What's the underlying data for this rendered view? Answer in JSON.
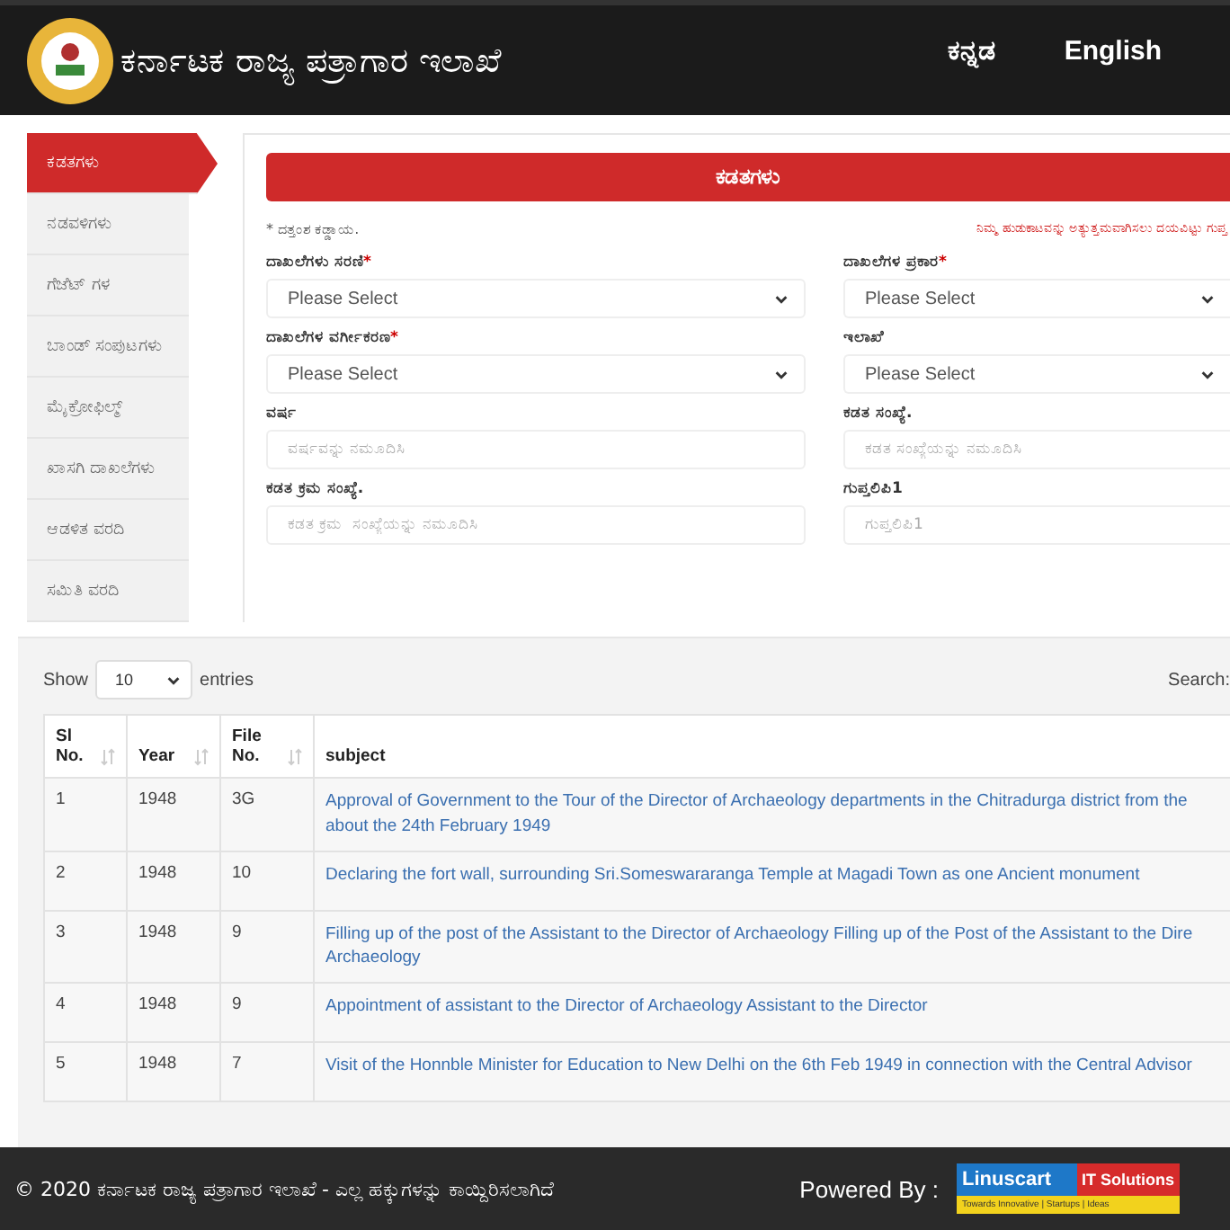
{
  "header": {
    "title": "ಕರ್ನಾಟಕ ರಾಜ್ಯ ಪತ್ರಾಗಾರ ಇಲಾಖೆ",
    "languages": [
      {
        "label": "ಕನ್ನಡ"
      },
      {
        "label": "English"
      }
    ]
  },
  "sidebar": {
    "items": [
      {
        "label": "ಕಡತಗಳು",
        "selected": true
      },
      {
        "label": "ನಡವಳಿಗಳು",
        "selected": false
      },
      {
        "label": "ಗೆಜೆಟ್ ಗಳ",
        "selected": false
      },
      {
        "label": "ಬಾಂಡ್ ಸಂಪುಟಗಳು",
        "selected": false
      },
      {
        "label": "ಮೈಕ್ರೋಫಿಲ್ಮ್",
        "selected": false
      },
      {
        "label": "ಖಾಸಗಿ ದಾಖಲೆಗಳು",
        "selected": false
      },
      {
        "label": "ಆಡಳಿತ ವರದಿ",
        "selected": false
      },
      {
        "label": "ಸಮಿತಿ ವರದಿ",
        "selected": false
      }
    ]
  },
  "form": {
    "title": "ಕಡತಗಳು",
    "mandatory_note": "* ದತ್ತಂಶ ಕಡ್ಡಾಯ.",
    "hint": "ನಿಮ್ಮ ಹುಡುಕಾಟವನ್ನು ಅತ್ಯುತ್ತಮವಾಗಿಸಲು ದಯವಿಟ್ಟು ಗುಪ್ತ",
    "fields": [
      {
        "kind": "select",
        "label": "ದಾಖಲೆಗಳು ಸರಣಿ",
        "required_mark": "*",
        "value": "Please Select"
      },
      {
        "kind": "select",
        "label": "ದಾಖಲೆಗಳ ಪ್ರಕಾರ",
        "required_mark": "*",
        "value": "Please Select"
      },
      {
        "kind": "select",
        "label": "ದಾಖಲೆಗಳ ವರ್ಗೀಕರಣ",
        "required_mark": "*",
        "value": "Please Select"
      },
      {
        "kind": "select",
        "label": "ಇಲಾಖೆ",
        "value": "Please Select"
      },
      {
        "kind": "input",
        "label": "ವರ್ಷ",
        "placeholder": "ವರ್ಷವನ್ನು ನಮೂದಿಸಿ"
      },
      {
        "kind": "input",
        "label": "ಕಡತ ಸಂಖ್ಯೆ.",
        "placeholder": "ಕಡತ ಸಂಖ್ಯೆಯನ್ನು ನಮೂದಿಸಿ"
      },
      {
        "kind": "input",
        "label": "ಕಡತ ಕ್ರಮ ಸಂಖ್ಯೆ.",
        "placeholder": "ಕಡತ ಕ್ರಮ  ಸಂಖ್ಯೆಯನ್ನು ನಮೂದಿಸಿ"
      },
      {
        "kind": "input",
        "label": "ಗುಪ್ತಲಿಪಿ1",
        "placeholder": "ಗುಪ್ತಲಿಪಿ1"
      }
    ]
  },
  "table": {
    "show_label": "Show",
    "page_size": "10",
    "entries_label": "entries",
    "search_label": "Search:",
    "columns": [
      {
        "label": "Sl No.",
        "sortable": true
      },
      {
        "label": "Year",
        "sortable": true
      },
      {
        "label": "File No.",
        "sortable": true
      },
      {
        "label": "subject",
        "sortable": false
      }
    ],
    "rows": [
      [
        "1",
        "1948",
        "3G",
        "Approval of Government to the Tour of the Director of Archaeology departments in the Chitradurga district from the about the 24th February 1949"
      ],
      [
        "2",
        "1948",
        "10",
        "Declaring the fort wall, surrounding Sri.Someswararanga Temple at Magadi Town as one Ancient monument"
      ],
      [
        "3",
        "1948",
        "9",
        "Filling up of the post of the Assistant to the Director of Archaeology Filling up of the Post of the Assistant to the Dire Archaeology"
      ],
      [
        "4",
        "1948",
        "9",
        "Appointment of assistant to the Director of Archaeology Assistant to the Director"
      ],
      [
        "5",
        "1948",
        "7",
        "Visit of the Honnble Minister for Education to New Delhi on the 6th Feb 1949 in connection with the Central Advisor"
      ]
    ]
  },
  "footer": {
    "copyright": "© 2020 ಕರ್ನಾಟಕ ರಾಜ್ಯ ಪತ್ರಾಗಾರ ಇಲಾಖೆ - ಎಲ್ಲ ಹಕ್ಕುಗಳನ್ನು ಕಾಯ್ದಿರಿಸಲಾಗಿದೆ",
    "powered_by": "Powered By :",
    "logo_name": "Linuscart",
    "logo_suffix": "IT Solutions",
    "logo_tagline": "Towards Innovative | Startups | Ideas"
  }
}
